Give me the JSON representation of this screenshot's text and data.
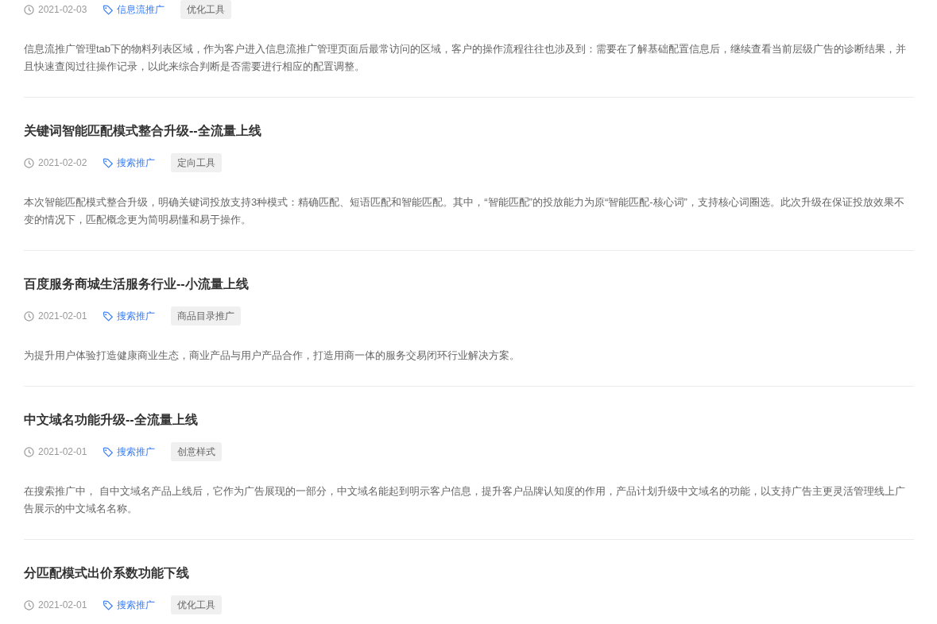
{
  "articles": [
    {
      "date": "2021-02-03",
      "channel": "信息流推广",
      "tag": "优化工具",
      "summary": "信息流推广管理tab下的物料列表区域，作为客户进入信息流推广管理页面后最常访问的区域，客户的操作流程往往也涉及到：需要在了解基础配置信息后，继续查看当前层级广告的诊断结果，并且快速查阅过往操作记录，以此来综合判断是否需要进行相应的配置调整。"
    },
    {
      "title": "关键词智能匹配模式整合升级--全流量上线",
      "date": "2021-02-02",
      "channel": "搜索推广",
      "tag": "定向工具",
      "summary": "本次智能匹配模式整合升级，明确关键词投放支持3种模式：精确匹配、短语匹配和智能匹配。其中，“智能匹配”的投放能力为原“智能匹配-核心词”，支持核心词圈选。此次升级在保证投放效果不变的情况下，匹配概念更为简明易懂和易于操作。"
    },
    {
      "title": "百度服务商城生活服务行业--小流量上线",
      "date": "2021-02-01",
      "channel": "搜索推广",
      "tag": "商品目录推广",
      "summary": "为提升用户体验打造健康商业生态，商业产品与用户产品合作，打造用商一体的服务交易闭环行业解决方案。"
    },
    {
      "title": "中文域名功能升级--全流量上线",
      "date": "2021-02-01",
      "channel": "搜索推广",
      "tag": "创意样式",
      "summary": "在搜索推广中， 自中文域名产品上线后，它作为广告展现的一部分，中文域名能起到明示客户信息，提升客户品牌认知度的作用，产品计划升级中文域名的功能，以支持广告主更灵活管理线上广告展示的中文域名名称。"
    },
    {
      "title": "分匹配模式出价系数功能下线",
      "date": "2021-02-01",
      "channel": "搜索推广",
      "tag": "优化工具"
    }
  ]
}
